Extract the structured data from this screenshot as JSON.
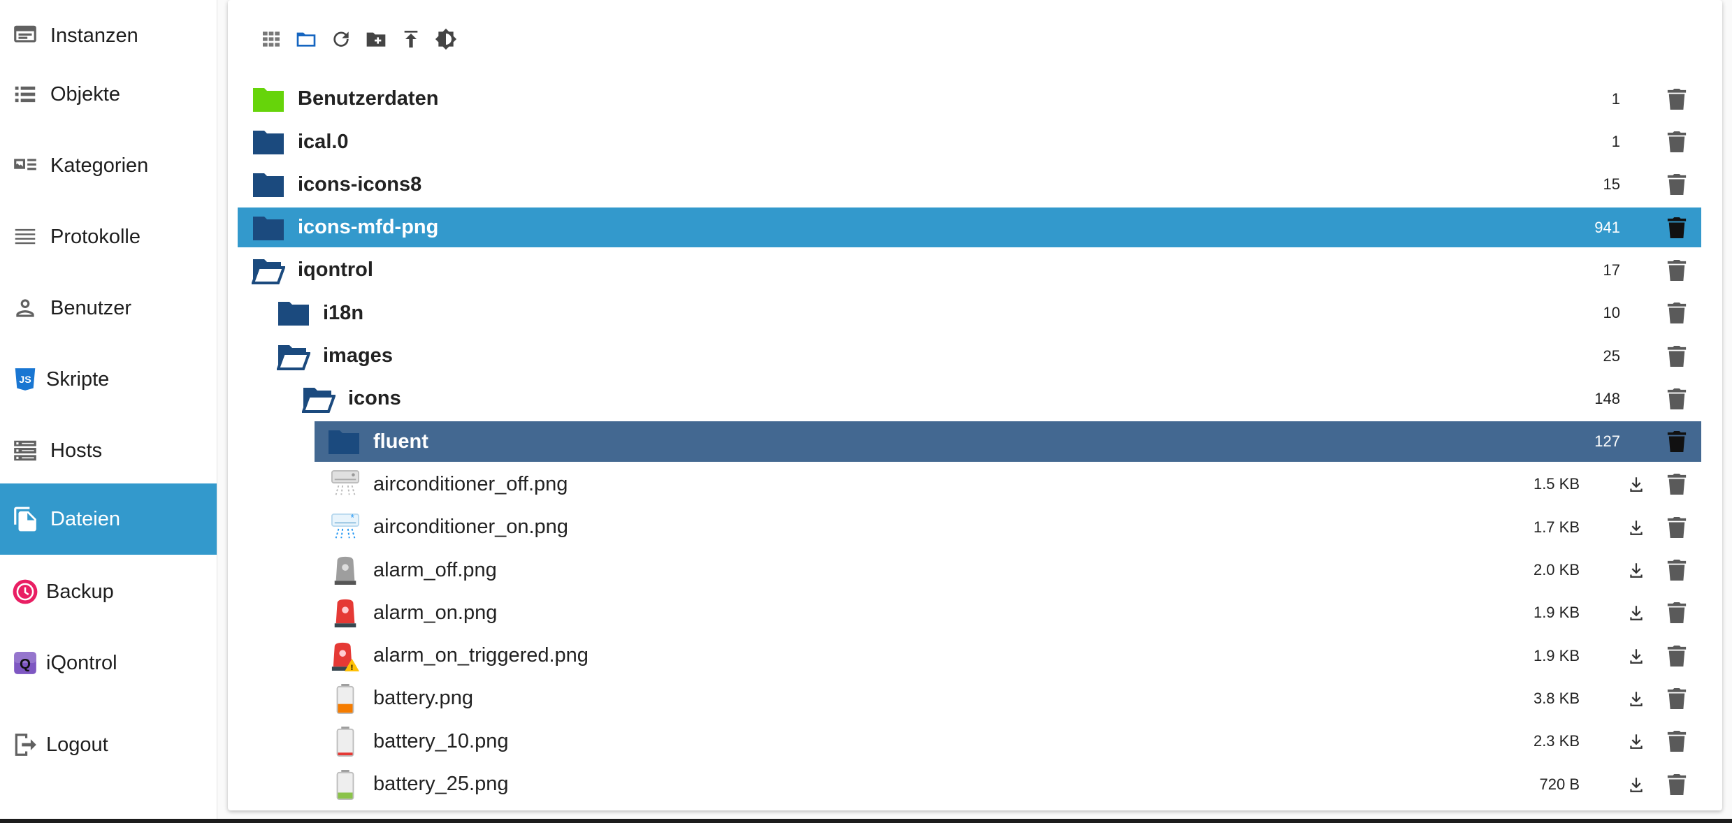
{
  "colors": {
    "accent": "#3399cc",
    "selected_dark": "#436891",
    "folder": "#1b4a7e",
    "folder_user": "#66d40a"
  },
  "sidebar": {
    "items": [
      {
        "label": "Instanzen",
        "icon": "instances-icon"
      },
      {
        "label": "Objekte",
        "icon": "list-icon"
      },
      {
        "label": "Kategorien",
        "icon": "category-icon"
      },
      {
        "label": "Protokolle",
        "icon": "log-icon"
      },
      {
        "label": "Benutzer",
        "icon": "user-icon"
      },
      {
        "label": "Skripte",
        "icon": "js-icon"
      },
      {
        "label": "Hosts",
        "icon": "hosts-icon"
      },
      {
        "label": "Dateien",
        "icon": "files-icon",
        "active": true
      },
      {
        "label": "Backup",
        "icon": "backup-icon"
      },
      {
        "label": "iQontrol",
        "icon": "iqontrol-icon"
      },
      {
        "label": "Logout",
        "icon": "logout-icon"
      }
    ]
  },
  "toolbar": {
    "buttons": [
      "grid-view-icon",
      "folder-view-icon",
      "refresh-icon",
      "add-folder-icon",
      "upload-icon",
      "brightness-icon"
    ]
  },
  "tree": {
    "folders": [
      {
        "name": "Benutzerdaten",
        "count": "1"
      },
      {
        "name": "ical.0",
        "count": "1"
      },
      {
        "name": "icons-icons8",
        "count": "15"
      },
      {
        "name": "icons-mfd-png",
        "count": "941"
      },
      {
        "name": "iqontrol",
        "count": "17"
      },
      {
        "name": "i18n",
        "count": "10"
      },
      {
        "name": "images",
        "count": "25"
      },
      {
        "name": "icons",
        "count": "148"
      },
      {
        "name": "fluent",
        "count": "127"
      }
    ],
    "files": [
      {
        "name": "airconditioner_off.png",
        "size": "1.5 KB",
        "icon": "airconditioner-off-icon"
      },
      {
        "name": "airconditioner_on.png",
        "size": "1.7 KB",
        "icon": "airconditioner-on-icon"
      },
      {
        "name": "alarm_off.png",
        "size": "2.0 KB",
        "icon": "alarm-off-icon"
      },
      {
        "name": "alarm_on.png",
        "size": "1.9 KB",
        "icon": "alarm-on-icon"
      },
      {
        "name": "alarm_on_triggered.png",
        "size": "1.9 KB",
        "icon": "alarm-triggered-icon"
      },
      {
        "name": "battery.png",
        "size": "3.8 KB",
        "icon": "battery-icon"
      },
      {
        "name": "battery_10.png",
        "size": "2.3 KB",
        "icon": "battery-10-icon"
      },
      {
        "name": "battery_25.png",
        "size": "720 B",
        "icon": "battery-25-icon"
      }
    ]
  }
}
